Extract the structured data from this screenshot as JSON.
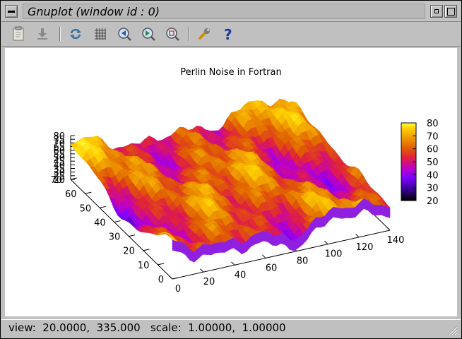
{
  "window": {
    "title": "Gnuplot (window id : 0)",
    "menu_button_icon": "window-menu-icon",
    "minimize_icon": "minimize-icon",
    "maximize_icon": "maximize-icon"
  },
  "toolbar": {
    "items": [
      {
        "name": "copy-clipboard",
        "icon": "clipboard-icon"
      },
      {
        "name": "export",
        "icon": "download-icon"
      },
      {
        "name": "replot",
        "icon": "refresh-icon"
      },
      {
        "name": "toggle-grid",
        "icon": "grid-icon"
      },
      {
        "name": "zoom-previous",
        "icon": "zoom-prev-icon"
      },
      {
        "name": "zoom-next",
        "icon": "zoom-next-icon"
      },
      {
        "name": "autoscale",
        "icon": "zoom-fit-icon"
      },
      {
        "name": "options",
        "icon": "wrench-icon"
      },
      {
        "name": "help",
        "icon": "help-icon"
      }
    ]
  },
  "colors": {
    "plot_background": "#ffffff",
    "palette": [
      "#000000",
      "#3a009a",
      "#8000ff",
      "#c000c0",
      "#e02040",
      "#e06000",
      "#f0a000",
      "#ffd000",
      "#ffff40"
    ]
  },
  "chart_data": {
    "type": "surface3d",
    "title": "Perlin Noise in Fortran",
    "x_ticks": [
      "0",
      "20",
      "40",
      "60",
      "80",
      "100",
      "120",
      "140"
    ],
    "y_ticks": [
      "0",
      "10",
      "20",
      "30",
      "40",
      "50",
      "60",
      "70"
    ],
    "z_ticks": [
      "20",
      "25",
      "30",
      "35",
      "40",
      "45",
      "50",
      "55",
      "60",
      "65",
      "70",
      "75",
      "80"
    ],
    "xlim": [
      0,
      140
    ],
    "ylim": [
      0,
      70
    ],
    "zlim": [
      20,
      80
    ],
    "colorbar_ticks": [
      "20",
      "30",
      "40",
      "50",
      "60",
      "70",
      "80"
    ],
    "colorbar_range": [
      20,
      80
    ]
  },
  "status": {
    "text": "view:  20.0000,  335.000   scale:  1.00000,  1.00000"
  }
}
